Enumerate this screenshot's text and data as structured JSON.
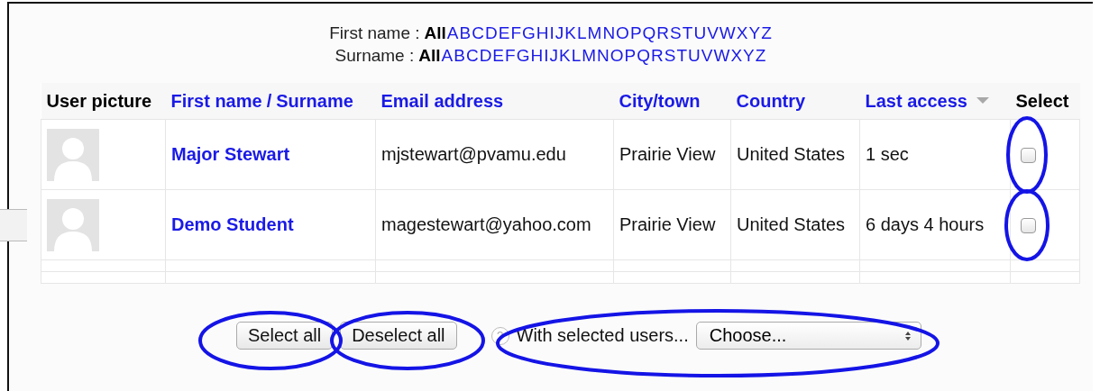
{
  "filters": [
    {
      "label": "First name :",
      "options": [
        {
          "text": "All",
          "selected": true
        },
        {
          "text": "A",
          "selected": false
        },
        {
          "text": "B",
          "selected": false
        },
        {
          "text": "C",
          "selected": false
        },
        {
          "text": "D",
          "selected": false
        },
        {
          "text": "E",
          "selected": false
        },
        {
          "text": "F",
          "selected": false
        },
        {
          "text": "G",
          "selected": false
        },
        {
          "text": "H",
          "selected": false
        },
        {
          "text": "I",
          "selected": false
        },
        {
          "text": "J",
          "selected": false
        },
        {
          "text": "K",
          "selected": false
        },
        {
          "text": "L",
          "selected": false
        },
        {
          "text": "M",
          "selected": false
        },
        {
          "text": "N",
          "selected": false
        },
        {
          "text": "O",
          "selected": false
        },
        {
          "text": "P",
          "selected": false
        },
        {
          "text": "Q",
          "selected": false
        },
        {
          "text": "R",
          "selected": false
        },
        {
          "text": "S",
          "selected": false
        },
        {
          "text": "T",
          "selected": false
        },
        {
          "text": "U",
          "selected": false
        },
        {
          "text": "V",
          "selected": false
        },
        {
          "text": "W",
          "selected": false
        },
        {
          "text": "X",
          "selected": false
        },
        {
          "text": "Y",
          "selected": false
        },
        {
          "text": "Z",
          "selected": false
        }
      ]
    },
    {
      "label": "Surname :",
      "options": [
        {
          "text": "All",
          "selected": true
        },
        {
          "text": "A",
          "selected": false
        },
        {
          "text": "B",
          "selected": false
        },
        {
          "text": "C",
          "selected": false
        },
        {
          "text": "D",
          "selected": false
        },
        {
          "text": "E",
          "selected": false
        },
        {
          "text": "F",
          "selected": false
        },
        {
          "text": "G",
          "selected": false
        },
        {
          "text": "H",
          "selected": false
        },
        {
          "text": "I",
          "selected": false
        },
        {
          "text": "J",
          "selected": false
        },
        {
          "text": "K",
          "selected": false
        },
        {
          "text": "L",
          "selected": false
        },
        {
          "text": "M",
          "selected": false
        },
        {
          "text": "N",
          "selected": false
        },
        {
          "text": "O",
          "selected": false
        },
        {
          "text": "P",
          "selected": false
        },
        {
          "text": "Q",
          "selected": false
        },
        {
          "text": "R",
          "selected": false
        },
        {
          "text": "S",
          "selected": false
        },
        {
          "text": "T",
          "selected": false
        },
        {
          "text": "U",
          "selected": false
        },
        {
          "text": "V",
          "selected": false
        },
        {
          "text": "W",
          "selected": false
        },
        {
          "text": "X",
          "selected": false
        },
        {
          "text": "Y",
          "selected": false
        },
        {
          "text": "Z",
          "selected": false
        }
      ]
    }
  ],
  "table": {
    "columns": [
      {
        "kind": "text",
        "parts": [
          "User picture"
        ]
      },
      {
        "kind": "link",
        "parts": [
          "First name",
          "/",
          "Surname"
        ]
      },
      {
        "kind": "link",
        "parts": [
          "Email address"
        ]
      },
      {
        "kind": "link",
        "parts": [
          "City/town"
        ]
      },
      {
        "kind": "link",
        "parts": [
          "Country"
        ]
      },
      {
        "kind": "link",
        "parts": [
          "Last access"
        ],
        "sorted": true
      },
      {
        "kind": "text",
        "parts": [
          "Select"
        ]
      }
    ],
    "rows": [
      {
        "name": "Major Stewart",
        "email": "mjstewart@pvamu.edu",
        "city": "Prairie View",
        "country": "United States",
        "last_access": "1 sec",
        "checked": false
      },
      {
        "name": "Demo Student",
        "email": "magestewart@yahoo.com",
        "city": "Prairie View",
        "country": "United States",
        "last_access": "6 days 4 hours",
        "checked": false
      }
    ]
  },
  "actions": {
    "buttons": [
      "Select all",
      "Deselect all"
    ],
    "help": "?",
    "label": "With selected users...",
    "dropdown": {
      "value": "Choose..."
    }
  }
}
